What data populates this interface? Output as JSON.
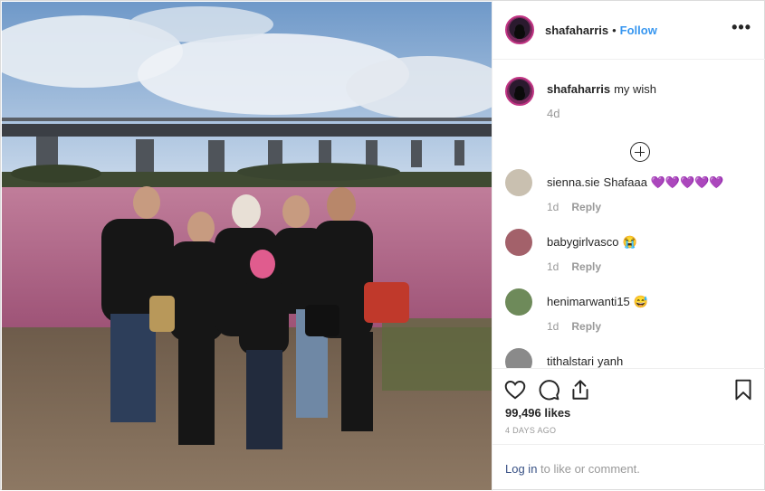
{
  "post": {
    "username": "shafaharris",
    "separator": "•",
    "follow_label": "Follow",
    "more_label": "•••"
  },
  "caption": {
    "username": "shafaharris",
    "text": "my wish",
    "time": "4d"
  },
  "comments": [
    {
      "username": "sienna.sie",
      "text": "Shafaaa 💜💜💜💜💜",
      "time": "1d",
      "reply": "Reply",
      "avatar_color": "#c9c0b0"
    },
    {
      "username": "babygirlvasco",
      "text": "😭",
      "time": "1d",
      "reply": "Reply",
      "avatar_color": "#a3616a"
    },
    {
      "username": "henimarwanti15",
      "text": "😅",
      "time": "1d",
      "reply": "Reply",
      "avatar_color": "#6e8a5a"
    },
    {
      "username": "tithalstari",
      "text": "yanh",
      "time": "",
      "reply": "",
      "avatar_color": "#8a8a8a"
    }
  ],
  "actions": {
    "likes": "99,496 likes",
    "date": "4 DAYS AGO"
  },
  "footer": {
    "login_link": "Log in",
    "login_rest": " to like or comment."
  },
  "icons": {
    "like": "heart-icon",
    "comment": "comment-icon",
    "share": "share-icon",
    "save": "bookmark-icon"
  },
  "colors": {
    "link_blue": "#3897f0",
    "login_blue": "#385185",
    "muted": "#999999",
    "lake": "#b56a8a"
  }
}
